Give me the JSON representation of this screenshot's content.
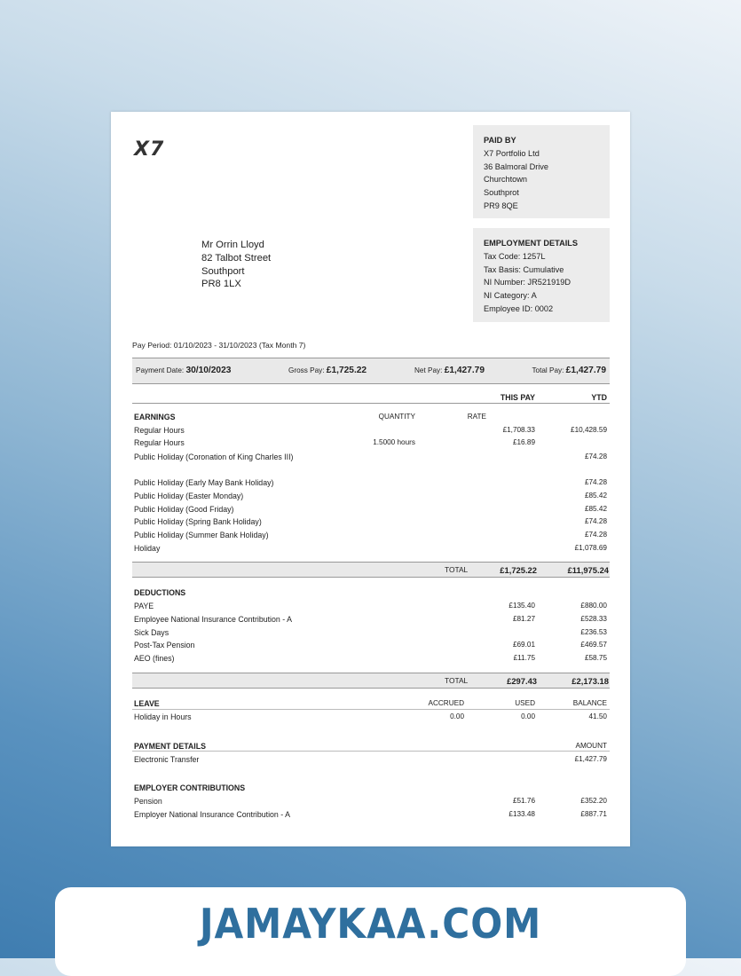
{
  "logo": "X7",
  "paid_by": {
    "heading": "PAID BY",
    "lines": [
      "X7 Portfolio Ltd",
      "36 Balmoral Drive",
      "Churchtown",
      "Southprot",
      "PR9 8QE"
    ]
  },
  "employment": {
    "heading": "EMPLOYMENT DETAILS",
    "lines": [
      "Tax Code: 1257L",
      "Tax Basis: Cumulative",
      "NI Number: JR521919D",
      "NI Category: A",
      "Employee ID: 0002"
    ]
  },
  "address": [
    "Mr Orrin Lloyd",
    "82 Talbot Street",
    "Southport",
    "PR8 1LX"
  ],
  "pay_period": "Pay Period: 01/10/2023 - 31/10/2023 (Tax Month 7)",
  "summary": {
    "payment_date_label": "Payment Date:",
    "payment_date": "30/10/2023",
    "gross_label": "Gross Pay:",
    "gross": "£1,725.22",
    "net_label": "Net Pay:",
    "net": "£1,427.79",
    "total_label": "Total Pay:",
    "total": "£1,427.79"
  },
  "columns": {
    "this_pay": "THIS PAY",
    "ytd": "YTD"
  },
  "earnings": {
    "heading": "EARNINGS",
    "qty_label": "QUANTITY",
    "rate_label": "RATE",
    "rows": [
      {
        "name": "Regular Hours",
        "qty": "",
        "rate": "",
        "this": "£1,708.33",
        "ytd": "£10,428.59"
      },
      {
        "name": "Regular Hours",
        "qty": "1.5000 hours",
        "rate": "",
        "this": "£16.89",
        "ytd": ""
      },
      {
        "name": "Public Holiday (Coronation of King Charles III)",
        "qty": "",
        "rate": "",
        "this": "",
        "ytd": "£74.28"
      },
      {
        "name": "Public Holiday (Early May Bank Holiday)",
        "qty": "",
        "rate": "",
        "this": "",
        "ytd": "£74.28"
      },
      {
        "name": "Public Holiday (Easter Monday)",
        "qty": "",
        "rate": "",
        "this": "",
        "ytd": "£85.42"
      },
      {
        "name": "Public Holiday (Good Friday)",
        "qty": "",
        "rate": "",
        "this": "",
        "ytd": "£85.42"
      },
      {
        "name": "Public Holiday (Spring Bank Holiday)",
        "qty": "",
        "rate": "",
        "this": "",
        "ytd": "£74.28"
      },
      {
        "name": "Public Holiday (Summer Bank Holiday)",
        "qty": "",
        "rate": "",
        "this": "",
        "ytd": "£74.28"
      },
      {
        "name": "Holiday",
        "qty": "",
        "rate": "",
        "this": "",
        "ytd": "£1,078.69"
      }
    ],
    "total_label": "TOTAL",
    "total_this": "£1,725.22",
    "total_ytd": "£11,975.24"
  },
  "deductions": {
    "heading": "DEDUCTIONS",
    "rows": [
      {
        "name": "PAYE",
        "this": "£135.40",
        "ytd": "£880.00"
      },
      {
        "name": "Employee National Insurance Contribution - A",
        "this": "£81.27",
        "ytd": "£528.33"
      },
      {
        "name": "Sick Days",
        "this": "",
        "ytd": "£236.53"
      },
      {
        "name": "Post-Tax Pension",
        "this": "£69.01",
        "ytd": "£469.57"
      },
      {
        "name": "AEO (fines)",
        "this": "£11.75",
        "ytd": "£58.75"
      }
    ],
    "total_label": "TOTAL",
    "total_this": "£297.43",
    "total_ytd": "£2,173.18"
  },
  "leave": {
    "heading": "LEAVE",
    "accrued_label": "ACCRUED",
    "used_label": "USED",
    "balance_label": "BALANCE",
    "rows": [
      {
        "name": "Holiday in Hours",
        "accrued": "0.00",
        "used": "0.00",
        "balance": "41.50"
      }
    ]
  },
  "payment_details": {
    "heading": "PAYMENT DETAILS",
    "amount_label": "AMOUNT",
    "rows": [
      {
        "name": "Electronic Transfer",
        "amount": "£1,427.79"
      }
    ]
  },
  "employer_contributions": {
    "heading": "EMPLOYER CONTRIBUTIONS",
    "rows": [
      {
        "name": "Pension",
        "this": "£51.76",
        "ytd": "£352.20"
      },
      {
        "name": "Employer National Insurance Contribution - A",
        "this": "£133.48",
        "ytd": "£887.71"
      }
    ]
  },
  "banner": "JAMAYKAA.COM"
}
